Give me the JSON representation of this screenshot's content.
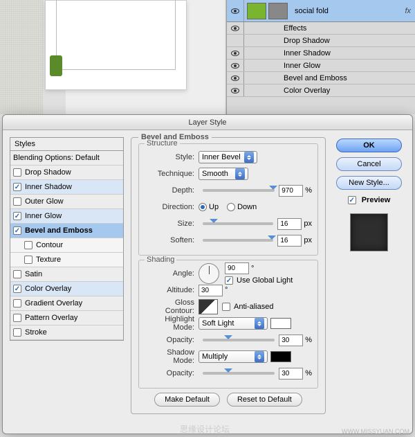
{
  "layers": {
    "main_layer_name": "social fold",
    "fx_label": "fx",
    "effects_header": "Effects",
    "effects": [
      "Drop Shadow",
      "Inner Shadow",
      "Inner Glow",
      "Bevel and Emboss",
      "Color Overlay"
    ]
  },
  "dialog": {
    "title": "Layer Style",
    "styles_header": "Styles",
    "blending_label": "Blending Options: Default",
    "style_items": [
      {
        "label": "Drop Shadow",
        "checked": false
      },
      {
        "label": "Inner Shadow",
        "checked": true
      },
      {
        "label": "Outer Glow",
        "checked": false
      },
      {
        "label": "Inner Glow",
        "checked": true
      },
      {
        "label": "Bevel and Emboss",
        "checked": true,
        "selected": true
      },
      {
        "label": "Contour",
        "checked": false,
        "sub": true
      },
      {
        "label": "Texture",
        "checked": false,
        "sub": true
      },
      {
        "label": "Satin",
        "checked": false
      },
      {
        "label": "Color Overlay",
        "checked": true
      },
      {
        "label": "Gradient Overlay",
        "checked": false
      },
      {
        "label": "Pattern Overlay",
        "checked": false
      },
      {
        "label": "Stroke",
        "checked": false
      }
    ],
    "panel_title": "Bevel and Emboss",
    "structure": {
      "legend": "Structure",
      "style_label": "Style:",
      "style_value": "Inner Bevel",
      "technique_label": "Technique:",
      "technique_value": "Smooth",
      "depth_label": "Depth:",
      "depth_value": "970",
      "depth_unit": "%",
      "direction_label": "Direction:",
      "up": "Up",
      "down": "Down",
      "size_label": "Size:",
      "size_value": "16",
      "size_unit": "px",
      "soften_label": "Soften:",
      "soften_value": "16",
      "soften_unit": "px"
    },
    "shading": {
      "legend": "Shading",
      "angle_label": "Angle:",
      "angle_value": "90",
      "angle_unit": "°",
      "global_light": "Use Global Light",
      "altitude_label": "Altitude:",
      "altitude_value": "30",
      "altitude_unit": "°",
      "gloss_label": "Gloss Contour:",
      "anti_aliased": "Anti-aliased",
      "highlight_mode_label": "Highlight Mode:",
      "highlight_mode_value": "Soft Light",
      "highlight_color": "#ffffff",
      "h_opacity_label": "Opacity:",
      "h_opacity_value": "30",
      "h_opacity_unit": "%",
      "shadow_mode_label": "Shadow Mode:",
      "shadow_mode_value": "Multiply",
      "shadow_color": "#000000",
      "s_opacity_label": "Opacity:",
      "s_opacity_value": "30",
      "s_opacity_unit": "%"
    },
    "make_default": "Make Default",
    "reset_default": "Reset to Default",
    "ok": "OK",
    "cancel": "Cancel",
    "new_style": "New Style...",
    "preview": "Preview"
  },
  "watermark": "WWW.MISSYUAN.COM",
  "watermark2": "思缘设计论坛"
}
